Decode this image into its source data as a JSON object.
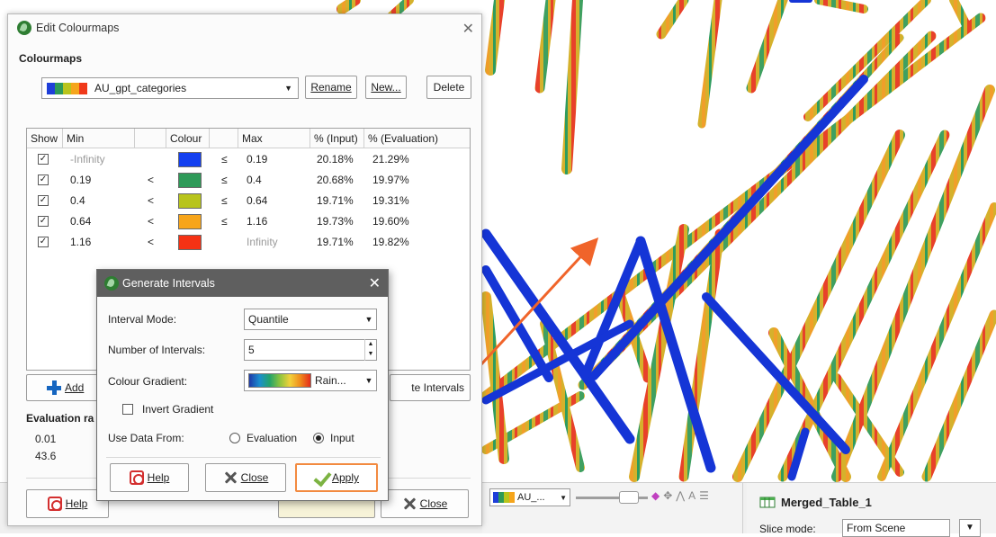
{
  "main_dialog": {
    "title": "Edit Colourmaps",
    "section_label": "Colourmaps",
    "colourmap_name": "AU_gpt_categories",
    "colourmap_swatches": [
      "#1f3fd9",
      "#2e9a58",
      "#b8c41c",
      "#f5a51c",
      "#f0391a"
    ],
    "buttons": {
      "rename": "Rename",
      "new": "New...",
      "delete": "Delete"
    },
    "table": {
      "headers": [
        "Show",
        "Min",
        "Colour",
        "Max",
        "% (Input)",
        "% (Evaluation)"
      ],
      "rows": [
        {
          "min": "-Infinity",
          "min_op": "",
          "colour": "#1440f0",
          "max_op": "≤",
          "max": "0.19",
          "pct_input": "20.18%",
          "pct_eval": "21.29%"
        },
        {
          "min": "0.19",
          "min_op": "<",
          "colour": "#2e9a58",
          "max_op": "≤",
          "max": "0.4",
          "pct_input": "20.68%",
          "pct_eval": "19.97%"
        },
        {
          "min": "0.4",
          "min_op": "<",
          "colour": "#b8c41c",
          "max_op": "≤",
          "max": "0.64",
          "pct_input": "19.71%",
          "pct_eval": "19.31%"
        },
        {
          "min": "0.64",
          "min_op": "<",
          "colour": "#f7a51a",
          "max_op": "≤",
          "max": "1.16",
          "pct_input": "19.73%",
          "pct_eval": "19.60%"
        },
        {
          "min": "1.16",
          "min_op": "<",
          "colour": "#f53214",
          "max_op": "",
          "max": "Infinity",
          "pct_input": "19.71%",
          "pct_eval": "19.82%"
        }
      ]
    },
    "add_label": "Add",
    "gen_intervals_label": "te Intervals",
    "evaluation_label": "Evaluation ra",
    "eval_min": "0.01",
    "eval_max": "43.6",
    "help_label": "Help",
    "close_label": "Close"
  },
  "gen_dialog": {
    "title": "Generate Intervals",
    "interval_mode_label": "Interval Mode:",
    "interval_mode_value": "Quantile",
    "num_intervals_label": "Number of Intervals:",
    "num_intervals_value": "5",
    "gradient_label": "Colour Gradient:",
    "gradient_value": "Rain...",
    "invert_label": "Invert Gradient",
    "use_data_label": "Use Data From:",
    "opt_evaluation": "Evaluation",
    "opt_input": "Input",
    "help": "Help",
    "close": "Close",
    "apply": "Apply"
  },
  "scene_toolbar": {
    "colourmap_short": "AU_..."
  },
  "right_panel": {
    "title": "Merged_Table_1",
    "slice_label": "Slice mode:",
    "slice_value": "From Scene"
  },
  "colors": {
    "accent": "#f28a40",
    "arrow": "#f0642a",
    "title_bar_dark": "#5f5f5f"
  }
}
